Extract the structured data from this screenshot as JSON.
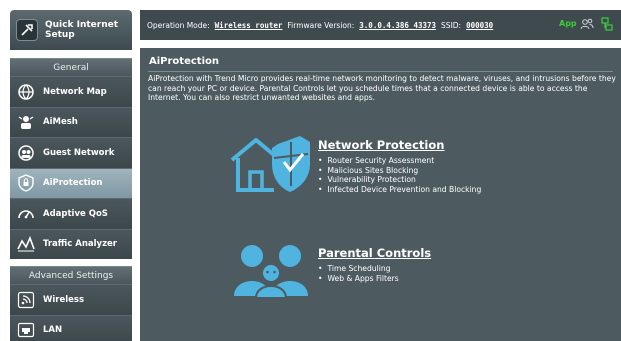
{
  "sidebar": {
    "quick_setup": {
      "label": "Quick Internet Setup",
      "icon": "quick-setup-icon"
    },
    "general_heading": "General",
    "general_items": [
      {
        "label": "Network Map",
        "icon": "globe-network-icon",
        "active": false
      },
      {
        "label": "AiMesh",
        "icon": "aimesh-icon",
        "active": false
      },
      {
        "label": "Guest Network",
        "icon": "guest-network-icon",
        "active": false
      },
      {
        "label": "AiProtection",
        "icon": "shield-lock-icon",
        "active": true
      },
      {
        "label": "Adaptive QoS",
        "icon": "speedometer-icon",
        "active": false
      },
      {
        "label": "Traffic Analyzer",
        "icon": "traffic-analyzer-icon",
        "active": false
      }
    ],
    "advanced_heading": "Advanced Settings",
    "advanced_items": [
      {
        "label": "Wireless",
        "icon": "wireless-icon"
      },
      {
        "label": "LAN",
        "icon": "lan-icon"
      }
    ]
  },
  "topbar": {
    "mode_label": "Operation Mode:",
    "mode_value": "Wireless router",
    "firmware_label": "Firmware Version:",
    "firmware_value": "3.0.0.4.386_43373",
    "ssid_label": "SSID:",
    "ssid_value": "000030",
    "app_label": "App",
    "icons": [
      "users-icon",
      "network-status-icon"
    ]
  },
  "main": {
    "title": "AiProtection",
    "description": "AiProtection with Trend Micro provides real-time network monitoring to detect malware, viruses, and intrusions before they can reach your PC or device. Parental Controls let you schedule times that a connected device is able to access the Internet. You can also restrict unwanted websites and apps.",
    "network_protection": {
      "title": "Network Protection",
      "icon": "home-shield-icon",
      "bullets": [
        "Router Security Assessment",
        "Malicious Sites Blocking",
        "Vulnerability Protection",
        "Infected Device Prevention and Blocking"
      ]
    },
    "parental_controls": {
      "title": "Parental Controls",
      "icon": "family-icon",
      "bullets": [
        "Time Scheduling",
        "Web & Apps Filters"
      ]
    }
  },
  "colors": {
    "panel": "#4d5b61",
    "sidebar_active": "#8fa6b0",
    "icon_blue": "#4fb4e0",
    "app_green": "#3ecb3e"
  }
}
